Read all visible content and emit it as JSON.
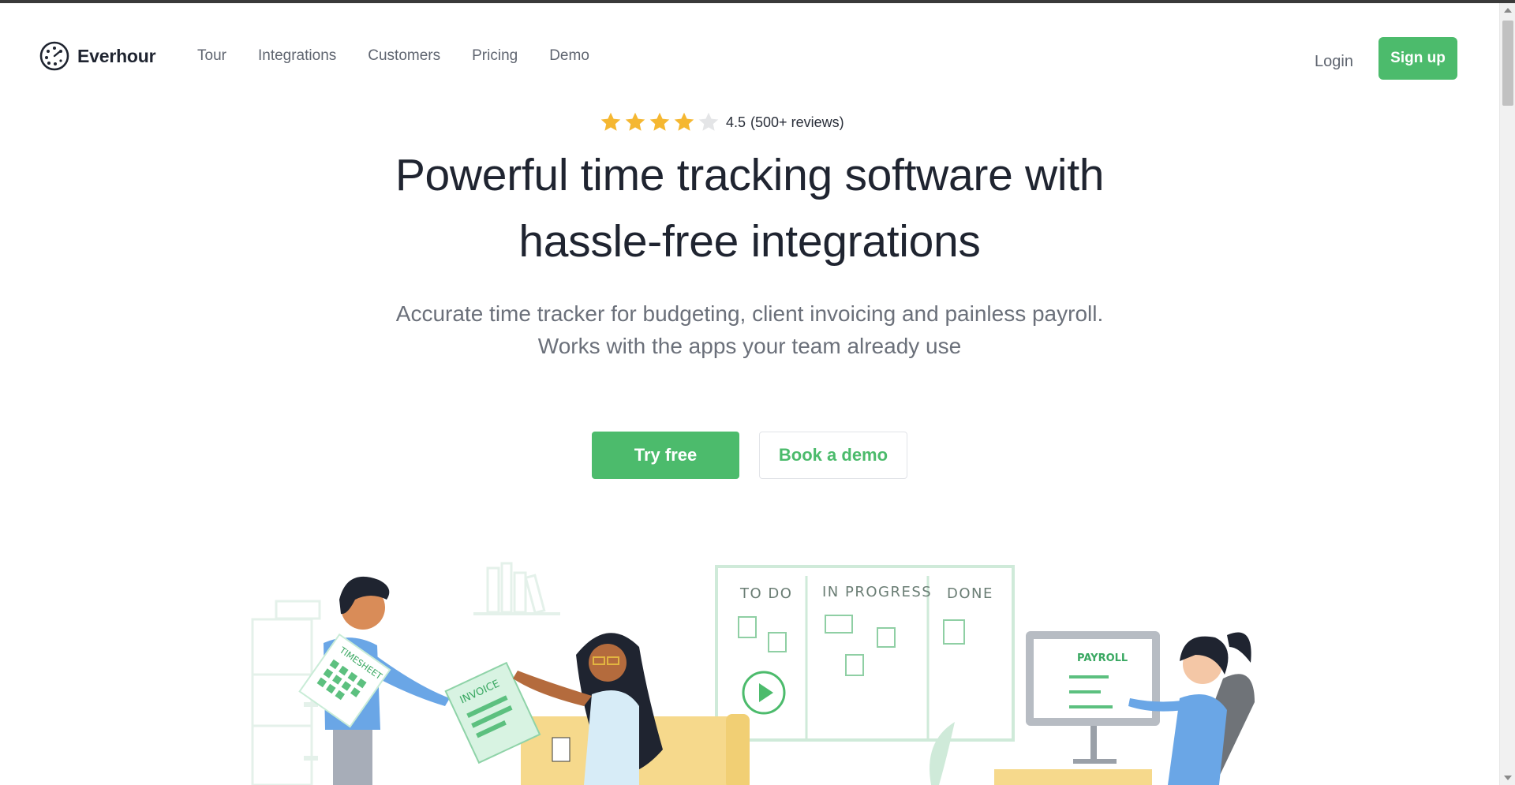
{
  "brand": {
    "name": "Everhour",
    "accent": "#4cbb6c"
  },
  "nav": {
    "items": [
      {
        "label": "Tour"
      },
      {
        "label": "Integrations"
      },
      {
        "label": "Customers"
      },
      {
        "label": "Pricing"
      },
      {
        "label": "Demo"
      }
    ],
    "login": "Login",
    "signup": "Sign up"
  },
  "rating": {
    "stars": 4.5,
    "max_stars": 5,
    "score": "4.5",
    "reviews": "(500+ reviews)",
    "star_color": "#f5b731"
  },
  "hero": {
    "title_line1": "Powerful time tracking software with",
    "title_line2": "hassle-free integrations",
    "subtitle_line1": "Accurate time tracker for budgeting, client invoicing and painless payroll.",
    "subtitle_line2": "Works with the apps your team already use",
    "try_free": "Try free",
    "book_demo": "Book a demo"
  },
  "illustration": {
    "board_columns": [
      "TO DO",
      "IN PROGRESS",
      "DONE"
    ],
    "timesheet": "TIMESHEET",
    "invoice": "INVOICE",
    "payroll": "PAYROLL"
  }
}
